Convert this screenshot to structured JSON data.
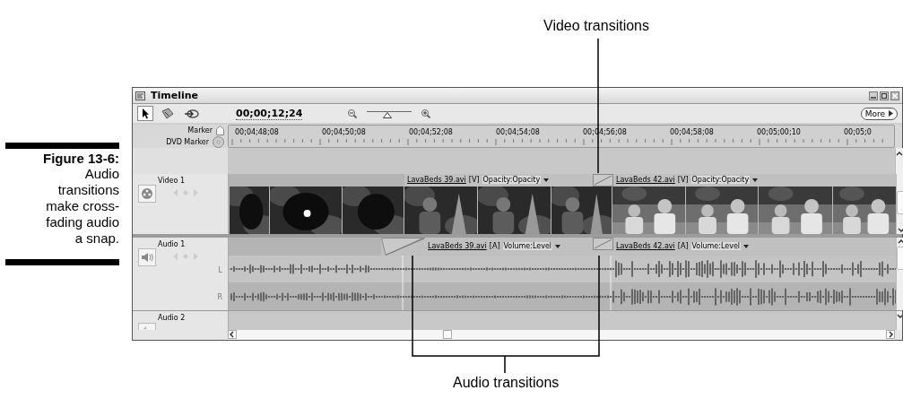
{
  "callouts": [
    {
      "kind": "video",
      "text": "Video transitions"
    },
    {
      "kind": "audio",
      "text": "Audio transitions"
    }
  ],
  "caption": {
    "label": "Figure 13-6:",
    "text": "Audio transitions make cross-fading audio a snap."
  },
  "window": {
    "title": "Timeline",
    "timecode": "00;00;12;24",
    "zoom_slider": {
      "level": 0.45
    },
    "more_button": "More"
  },
  "ruler": {
    "labels": [
      "Marker",
      "DVD Marker"
    ],
    "times": [
      "00;04;48;08",
      "00;04;50;08",
      "00;04;52;08",
      "00;04;54;08",
      "00;04;56;08",
      "00;04;58;08",
      "00;05;00;10",
      "00;05;0"
    ]
  },
  "tracks": [
    {
      "kind": "video",
      "name": "Video 1",
      "clips": [
        {
          "file": "LavaBeds 39.avi",
          "tag": "[V]",
          "effect": "Opacity:Opacity"
        },
        {
          "file": "LavaBeds 42.avi",
          "tag": "[V]",
          "effect": "Opacity:Opacity"
        }
      ]
    },
    {
      "kind": "audio",
      "name": "Audio 1",
      "channels": [
        "L",
        "R"
      ],
      "clips": [
        {
          "file": "LavaBeds 39.avi",
          "tag": "[A]",
          "effect": "Volume:Level"
        },
        {
          "file": "LavaBeds 42.avi",
          "tag": "[A]",
          "effect": "Volume:Level"
        }
      ]
    },
    {
      "kind": "audio_collapsed",
      "name": "Audio 2"
    }
  ]
}
